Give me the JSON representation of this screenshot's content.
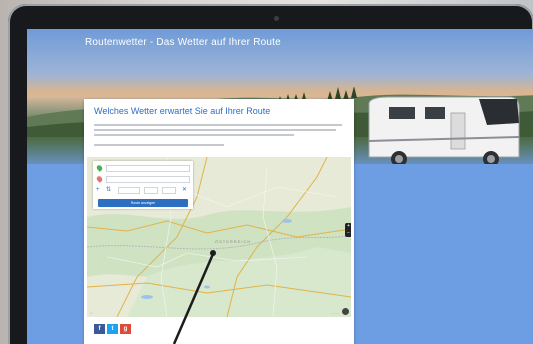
{
  "site": {
    "title": "Routenwetter - Das Wetter auf Ihrer Route"
  },
  "card": {
    "heading": "Welches Wetter erwartet Sie auf Ihrer Route"
  },
  "map": {
    "country_label": "ÖSTERREICH",
    "route_button": "Route anzeigen",
    "zoom_in": "+",
    "zoom_out": "−"
  },
  "share": {
    "facebook": "f",
    "twitter": "t",
    "google": "g"
  },
  "colors": {
    "accent": "#2c6fc2",
    "start_pin": "#4caf50",
    "end_pin": "#e57373",
    "facebook": "#3b5998",
    "twitter": "#1da1f2",
    "google": "#dd4b39"
  }
}
